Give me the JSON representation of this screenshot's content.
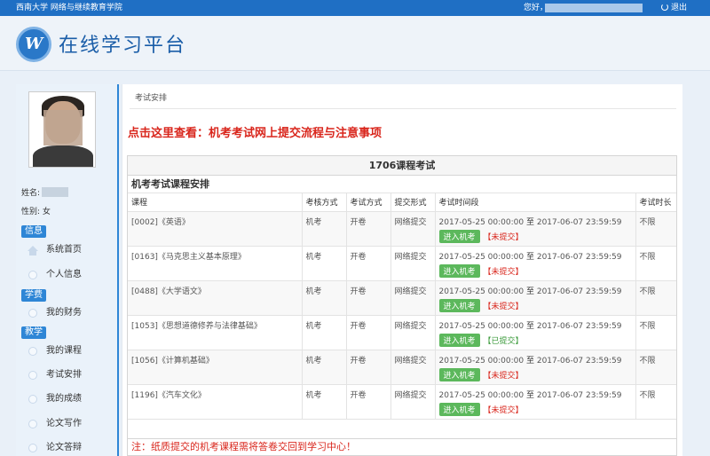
{
  "topbar": {
    "school": "西南大学 网络与继续教育学院",
    "greeting": "您好，",
    "logout": "退出"
  },
  "header": {
    "logo_letter": "W",
    "title": "在线学习平台"
  },
  "profile": {
    "name_label": "姓名:",
    "gender_label": "性别:",
    "gender": "女"
  },
  "sidebar": {
    "sections": [
      {
        "label": "信息",
        "items": [
          "系统首页",
          "个人信息"
        ]
      },
      {
        "label": "学费",
        "items": [
          "我的财务"
        ]
      },
      {
        "label": "教学",
        "items": [
          "我的课程",
          "考试安排",
          "我的成绩",
          "论文写作",
          "论文答辩"
        ]
      }
    ]
  },
  "main": {
    "breadcrumb": "考试安排",
    "notice_link": "点击这里查看：机考考试网上提交流程与注意事项",
    "panel_title": "1706课程考试",
    "sub_title": "机考考试课程安排",
    "columns": [
      "课程",
      "考核方式",
      "考试方式",
      "提交形式",
      "考试时间段",
      "考试时长"
    ],
    "time_sep": "至",
    "btn_label": "进入机考",
    "rows": [
      {
        "course": "[0002]《英语》",
        "assess": "机考",
        "mode": "开卷",
        "submit": "网络提交",
        "start": "2017-05-25 00:00:00",
        "end": "2017-06-07 23:59:59",
        "status": "【未提交】",
        "done": false,
        "duration": "不限"
      },
      {
        "course": "[0163]《马克思主义基本原理》",
        "assess": "机考",
        "mode": "开卷",
        "submit": "网络提交",
        "start": "2017-05-25 00:00:00",
        "end": "2017-06-07 23:59:59",
        "status": "【未提交】",
        "done": false,
        "duration": "不限"
      },
      {
        "course": "[0488]《大学语文》",
        "assess": "机考",
        "mode": "开卷",
        "submit": "网络提交",
        "start": "2017-05-25 00:00:00",
        "end": "2017-06-07 23:59:59",
        "status": "【未提交】",
        "done": false,
        "duration": "不限"
      },
      {
        "course": "[1053]《思想道德修养与法律基础》",
        "assess": "机考",
        "mode": "开卷",
        "submit": "网络提交",
        "start": "2017-05-25 00:00:00",
        "end": "2017-06-07 23:59:59",
        "status": "【已提交】",
        "done": true,
        "duration": "不限"
      },
      {
        "course": "[1056]《计算机基础》",
        "assess": "机考",
        "mode": "开卷",
        "submit": "网络提交",
        "start": "2017-05-25 00:00:00",
        "end": "2017-06-07 23:59:59",
        "status": "【未提交】",
        "done": false,
        "duration": "不限"
      },
      {
        "course": "[1196]《汽车文化》",
        "assess": "机考",
        "mode": "开卷",
        "submit": "网络提交",
        "start": "2017-05-25 00:00:00",
        "end": "2017-06-07 23:59:59",
        "status": "【未提交】",
        "done": false,
        "duration": "不限"
      }
    ],
    "footnote": "注：纸质提交的机考课程需将答卷交回到学习中心！"
  }
}
